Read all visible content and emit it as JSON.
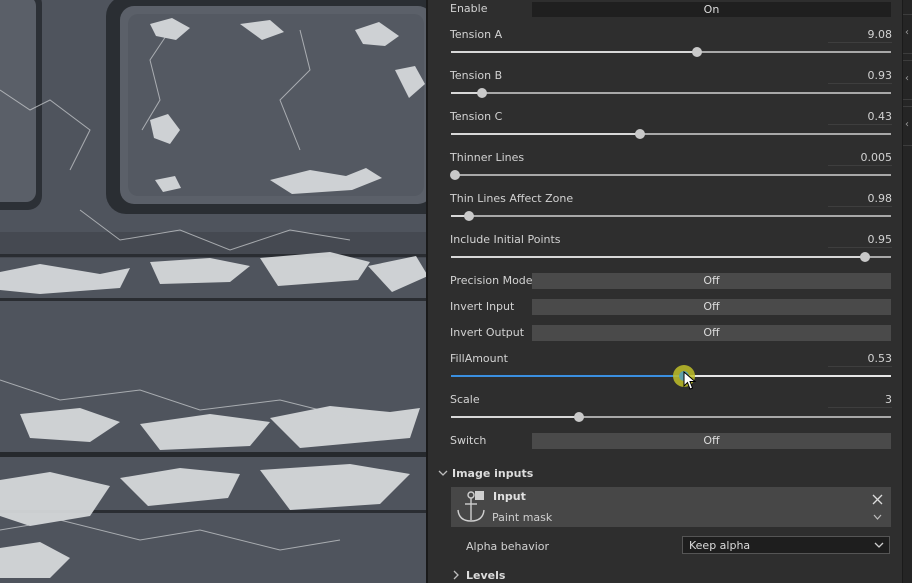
{
  "colors": {
    "accent": "#3a8fe0",
    "panel_bg": "#2e2e2e",
    "toggle_off": "#4a4a4a",
    "toggle_on": "#1f1f1f"
  },
  "params": {
    "enable": {
      "label": "Enable",
      "value": "On"
    },
    "tension_a": {
      "label": "Tension A",
      "value": "9.08",
      "fraction": 0.56
    },
    "tension_b": {
      "label": "Tension B",
      "value": "0.93",
      "fraction": 0.07
    },
    "tension_c": {
      "label": "Tension C",
      "value": "0.43",
      "fraction": 0.43
    },
    "thinner_lines": {
      "label": "Thinner Lines",
      "value": "0.005",
      "fraction": 0.01
    },
    "thin_lines_zone": {
      "label": "Thin Lines Affect Zone",
      "value": "0.98",
      "fraction": 0.04
    },
    "initial_points": {
      "label": "Include Initial Points",
      "value": "0.95",
      "fraction": 0.94
    },
    "precision_mode": {
      "label": "Precision Mode",
      "value": "Off"
    },
    "invert_input": {
      "label": "Invert Input",
      "value": "Off"
    },
    "invert_output": {
      "label": "Invert Output",
      "value": "Off"
    },
    "fill_amount": {
      "label": "FillAmount",
      "value": "0.53",
      "fraction": 0.53
    },
    "scale": {
      "label": "Scale",
      "value": "3",
      "fraction": 0.29
    },
    "switch": {
      "label": "Switch",
      "value": "Off"
    }
  },
  "image_inputs": {
    "section_label": "Image inputs",
    "input_title": "Input",
    "input_subtitle": "Paint mask",
    "alpha_label": "Alpha behavior",
    "alpha_value": "Keep alpha"
  },
  "levels": {
    "section_label": "Levels"
  },
  "icons": [
    "anchor-icon",
    "close-icon",
    "chevron-down-icon",
    "chevron-right-icon",
    "cursor-icon",
    "collapse-arrow-icon"
  ]
}
